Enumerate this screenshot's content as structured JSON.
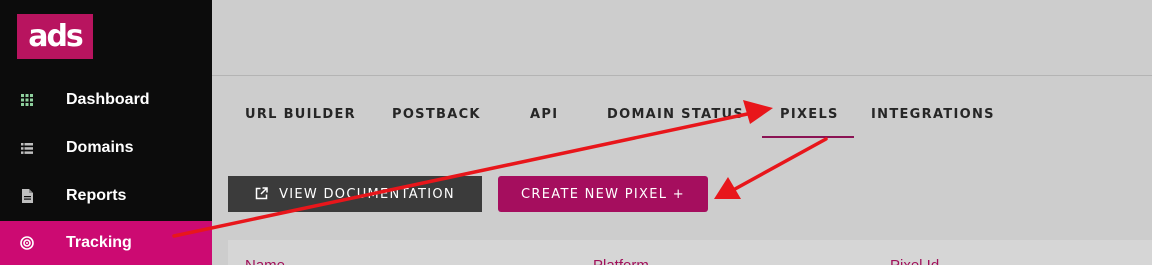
{
  "app": {
    "logo_text": "ads",
    "brand_color": "#b8145f",
    "active_color": "#cc0a72"
  },
  "sidebar": {
    "items": [
      {
        "label": "Dashboard",
        "icon": "grid-icon"
      },
      {
        "label": "Domains",
        "icon": "list-icon"
      },
      {
        "label": "Reports",
        "icon": "document-icon"
      },
      {
        "label": "Tracking",
        "icon": "radar-icon",
        "active": true
      }
    ]
  },
  "tabs": [
    {
      "label": "URL BUILDER"
    },
    {
      "label": "POSTBACK"
    },
    {
      "label": "API"
    },
    {
      "label": "DOMAIN STATUS"
    },
    {
      "label": "PIXELS",
      "active": true
    },
    {
      "label": "INTEGRATIONS"
    }
  ],
  "actions": {
    "view_documentation": "VIEW DOCUMENTATION",
    "create_new_pixel": "CREATE NEW PIXEL +"
  },
  "table": {
    "columns": [
      "Name",
      "Platform",
      "Pixel Id"
    ]
  },
  "annotations": {
    "arrow_color": "#e8161b"
  }
}
